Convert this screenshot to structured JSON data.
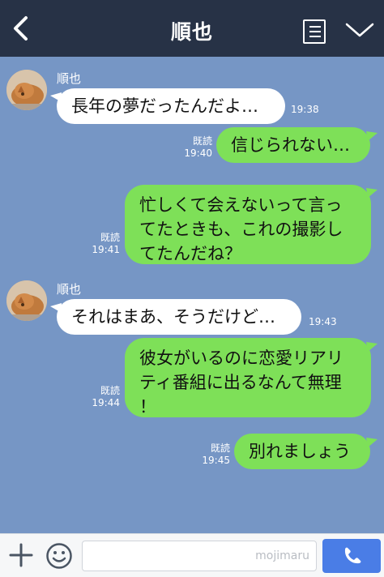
{
  "header": {
    "title": "順也"
  },
  "messages": [
    {
      "side": "left",
      "sender": "順也",
      "text": "長年の夢だったんだよ…",
      "time": "19:38"
    },
    {
      "side": "right",
      "read": "既読",
      "text": "信じられない…",
      "time": "19:40"
    },
    {
      "side": "right",
      "read": "既読",
      "lines": [
        "忙しくて会えないって言っ",
        "てたときも、これの撮影し",
        "てたんだね？"
      ],
      "time": "19:41"
    },
    {
      "side": "left",
      "sender": "順也",
      "text": "それはまあ、そうだけど…",
      "time": "19:43"
    },
    {
      "side": "right",
      "read": "既読",
      "lines": [
        "彼女がいるのに恋愛リアリ",
        "ティ番組に出るなんて無理",
        "！"
      ],
      "time": "19:44"
    },
    {
      "side": "right",
      "read": "既読",
      "text": "別れましょう",
      "time": "19:45"
    }
  ],
  "footer": {
    "watermark": "mojimaru"
  },
  "colors": {
    "header_bg": "#273246",
    "chat_bg": "#7696c5",
    "green_bubble": "#7ee058",
    "call_button": "#4a7de6"
  },
  "icons": {
    "back": "chevron-left-icon",
    "memo": "memo-icon",
    "menu": "chevron-down-icon",
    "add": "plus-icon",
    "emoji": "smiley-icon",
    "call": "phone-icon"
  }
}
